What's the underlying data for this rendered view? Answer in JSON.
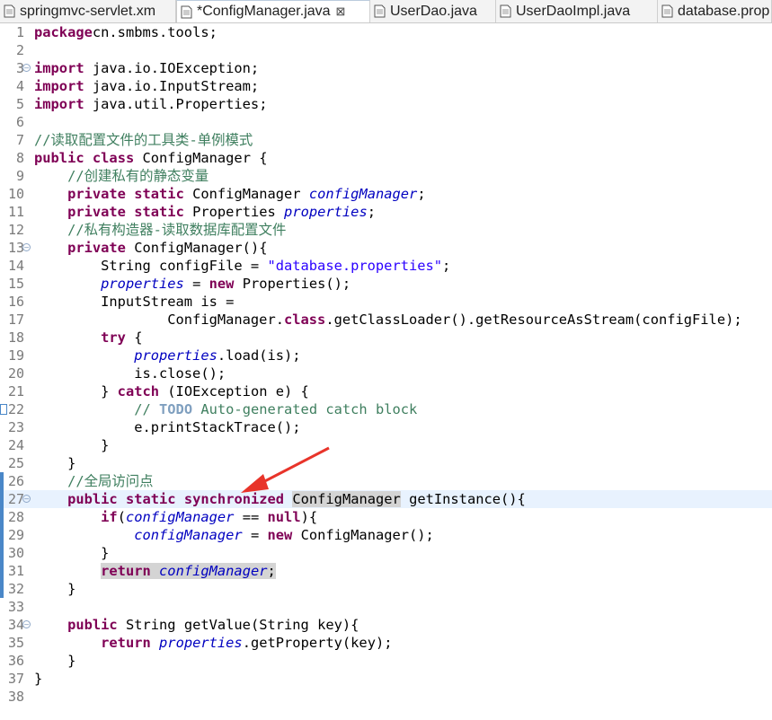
{
  "tabs": [
    {
      "label": "springmvc-servlet.xm",
      "icon": "xml-file-icon",
      "active": false
    },
    {
      "label": "*ConfigManager.java",
      "icon": "java-file-icon",
      "active": true,
      "close": "⊠"
    },
    {
      "label": "UserDao.java",
      "icon": "java-file-icon",
      "active": false
    },
    {
      "label": "UserDaoImpl.java",
      "icon": "java-file-icon",
      "active": false
    },
    {
      "label": "database.prop",
      "icon": "properties-file-icon",
      "active": false
    }
  ],
  "lines": [
    {
      "n": "1",
      "t": [
        [
          "k",
          "package"
        ],
        [
          "",
          "cn.smbms.tools;"
        ]
      ]
    },
    {
      "n": "2",
      "t": []
    },
    {
      "n": "3",
      "fold": true,
      "t": [
        [
          "k",
          "import"
        ],
        [
          "",
          " java.io.IOException;"
        ]
      ]
    },
    {
      "n": "4",
      "t": [
        [
          "k",
          "import"
        ],
        [
          "",
          " java.io.InputStream;"
        ]
      ]
    },
    {
      "n": "5",
      "t": [
        [
          "k",
          "import"
        ],
        [
          "",
          " java.util.Properties;"
        ]
      ]
    },
    {
      "n": "6",
      "t": []
    },
    {
      "n": "7",
      "t": [
        [
          "c",
          "//读取配置文件的工具类-单例模式"
        ]
      ]
    },
    {
      "n": "8",
      "t": [
        [
          "k",
          "public"
        ],
        [
          "",
          " "
        ],
        [
          "k",
          "class"
        ],
        [
          "",
          " ConfigManager {"
        ]
      ]
    },
    {
      "n": "9",
      "t": [
        [
          "",
          "    "
        ],
        [
          "c",
          "//创建私有的静态变量"
        ]
      ]
    },
    {
      "n": "10",
      "t": [
        [
          "",
          "    "
        ],
        [
          "k",
          "private"
        ],
        [
          "",
          " "
        ],
        [
          "k",
          "static"
        ],
        [
          "",
          " ConfigManager "
        ],
        [
          "f",
          "configManager"
        ],
        [
          "",
          ";"
        ]
      ]
    },
    {
      "n": "11",
      "t": [
        [
          "",
          "    "
        ],
        [
          "k",
          "private"
        ],
        [
          "",
          " "
        ],
        [
          "k",
          "static"
        ],
        [
          "",
          " Properties "
        ],
        [
          "f",
          "properties"
        ],
        [
          "",
          ";"
        ]
      ]
    },
    {
      "n": "12",
      "t": [
        [
          "",
          "    "
        ],
        [
          "c",
          "//私有构造器-读取数据库配置文件"
        ]
      ]
    },
    {
      "n": "13",
      "fold": true,
      "t": [
        [
          "",
          "    "
        ],
        [
          "k",
          "private"
        ],
        [
          "",
          " ConfigManager(){"
        ]
      ]
    },
    {
      "n": "14",
      "t": [
        [
          "",
          "        String configFile = "
        ],
        [
          "s",
          "\"database.properties\""
        ],
        [
          "",
          ";"
        ]
      ]
    },
    {
      "n": "15",
      "t": [
        [
          "",
          "        "
        ],
        [
          "f",
          "properties"
        ],
        [
          "",
          " = "
        ],
        [
          "k",
          "new"
        ],
        [
          "",
          " Properties();"
        ]
      ]
    },
    {
      "n": "16",
      "t": [
        [
          "",
          "        InputStream is ="
        ]
      ]
    },
    {
      "n": "17",
      "t": [
        [
          "",
          "                ConfigManager."
        ],
        [
          "k",
          "class"
        ],
        [
          "",
          ".getClassLoader().getResourceAsStream(configFile);"
        ]
      ]
    },
    {
      "n": "18",
      "t": [
        [
          "",
          "        "
        ],
        [
          "k",
          "try"
        ],
        [
          "",
          " {"
        ]
      ]
    },
    {
      "n": "19",
      "t": [
        [
          "",
          "            "
        ],
        [
          "f",
          "properties"
        ],
        [
          "",
          ".load(is);"
        ]
      ]
    },
    {
      "n": "20",
      "t": [
        [
          "",
          "            is.close();"
        ]
      ]
    },
    {
      "n": "21",
      "t": [
        [
          "",
          "        } "
        ],
        [
          "k",
          "catch"
        ],
        [
          "",
          " (IOException e) {"
        ]
      ]
    },
    {
      "n": "22",
      "warn": true,
      "t": [
        [
          "",
          "            "
        ],
        [
          "c",
          "// "
        ],
        [
          "todo",
          "TODO"
        ],
        [
          "c",
          " Auto-generated catch block"
        ]
      ]
    },
    {
      "n": "23",
      "t": [
        [
          "",
          "            e.printStackTrace();"
        ]
      ]
    },
    {
      "n": "24",
      "t": [
        [
          "",
          "        }"
        ]
      ]
    },
    {
      "n": "25",
      "t": [
        [
          "",
          "    }"
        ]
      ]
    },
    {
      "n": "26",
      "mark": true,
      "t": [
        [
          "",
          "    "
        ],
        [
          "c",
          "//全局访问点"
        ]
      ]
    },
    {
      "n": "27",
      "mark": true,
      "fold": true,
      "current": true,
      "t": [
        [
          "",
          "    "
        ],
        [
          "k",
          "public"
        ],
        [
          "",
          " "
        ],
        [
          "k",
          "static"
        ],
        [
          "",
          " "
        ],
        [
          "k",
          "synchronized"
        ],
        [
          "",
          " "
        ],
        [
          "occ",
          "ConfigManager"
        ],
        [
          "",
          " getInstance(){"
        ]
      ]
    },
    {
      "n": "28",
      "mark": true,
      "t": [
        [
          "",
          "        "
        ],
        [
          "k",
          "if"
        ],
        [
          "",
          "("
        ],
        [
          "f",
          "configManager"
        ],
        [
          "",
          " == "
        ],
        [
          "k",
          "null"
        ],
        [
          "",
          "){"
        ]
      ]
    },
    {
      "n": "29",
      "mark": true,
      "t": [
        [
          "",
          "            "
        ],
        [
          "f",
          "configManager"
        ],
        [
          "",
          " = "
        ],
        [
          "k",
          "new"
        ],
        [
          "",
          " ConfigManager();"
        ]
      ]
    },
    {
      "n": "30",
      "mark": true,
      "t": [
        [
          "",
          "        }"
        ]
      ]
    },
    {
      "n": "31",
      "mark": true,
      "t": [
        [
          "",
          "        "
        ],
        [
          "occ-k",
          "return"
        ],
        [
          "occ",
          " "
        ],
        [
          "occ-f",
          "configManager"
        ],
        [
          "occ",
          ";"
        ]
      ]
    },
    {
      "n": "32",
      "mark": true,
      "t": [
        [
          "",
          "    }"
        ]
      ]
    },
    {
      "n": "33",
      "t": []
    },
    {
      "n": "34",
      "fold": true,
      "t": [
        [
          "",
          "    "
        ],
        [
          "k",
          "public"
        ],
        [
          "",
          " String getValue(String key){"
        ]
      ]
    },
    {
      "n": "35",
      "t": [
        [
          "",
          "        "
        ],
        [
          "k",
          "return"
        ],
        [
          "",
          " "
        ],
        [
          "f",
          "properties"
        ],
        [
          "",
          ".getProperty(key);"
        ]
      ]
    },
    {
      "n": "36",
      "t": [
        [
          "",
          "    }"
        ]
      ]
    },
    {
      "n": "37",
      "t": [
        [
          "",
          "}"
        ]
      ]
    },
    {
      "n": "38",
      "t": []
    }
  ],
  "annotation": {
    "arrow_color": "#e8342a"
  }
}
